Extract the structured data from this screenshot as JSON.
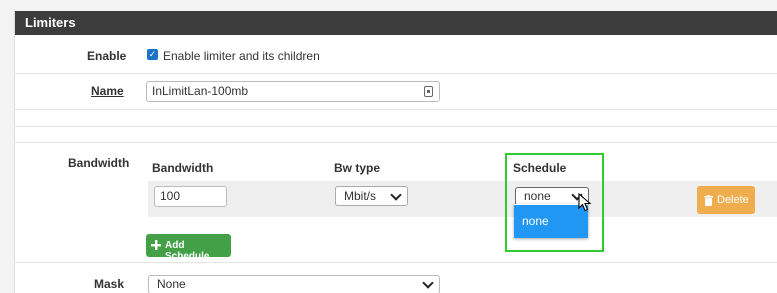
{
  "panel": {
    "title": "Limiters"
  },
  "enable": {
    "label": "Enable",
    "checkbox_text": "Enable limiter and its children",
    "checked": true
  },
  "name": {
    "label": "Name",
    "value": "InLimitLan-100mb"
  },
  "bandwidth": {
    "label": "Bandwidth",
    "columns": {
      "bandwidth": "Bandwidth",
      "bw_type": "Bw type",
      "schedule": "Schedule"
    },
    "row": {
      "bandwidth_value": "100",
      "bw_type_value": "Mbit/s",
      "schedule_value": "none"
    },
    "schedule_dropdown_options": [
      "none"
    ],
    "delete_label": "Delete",
    "add_schedule_label": "Add Schedule"
  },
  "mask": {
    "label": "Mask",
    "value": "None"
  },
  "icons": {
    "checkmark": "check-icon",
    "field": "form-field-icon",
    "trash": "trash-icon",
    "plus": "plus-icon",
    "cursor": "mouse-pointer-icon"
  },
  "colors": {
    "header": "#3c3c3c",
    "checkbox": "#1a73c9",
    "delete_button": "#f0ad4e",
    "add_button": "#43a047",
    "highlight_box": "#2ecc2e",
    "dropdown_selected": "#2196f3"
  }
}
